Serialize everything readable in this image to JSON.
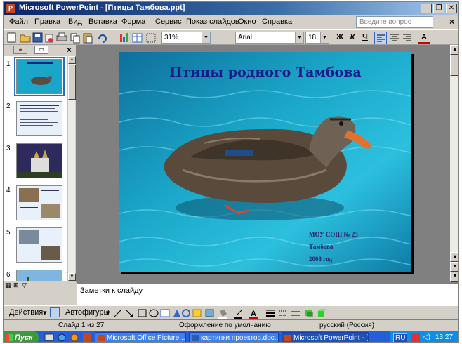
{
  "window": {
    "title": "Microsoft PowerPoint - [Птицы Тамбова.ppt]",
    "app_icon_letter": "P",
    "controls": {
      "minimize": "_",
      "restore": "❐",
      "close": "✕"
    }
  },
  "menubar": {
    "items": [
      "Файл",
      "Правка",
      "Вид",
      "Вставка",
      "Формат",
      "Сервис",
      "Показ слайдов",
      "Окно",
      "Справка"
    ],
    "ask_placeholder": "Введите вопрос",
    "doc_close": "×"
  },
  "toolbar": {
    "zoom": "31%",
    "font": "Arial",
    "font_size": "18",
    "bold": "Ж",
    "italic": "К",
    "underline": "Ч",
    "font_color_letter": "A"
  },
  "thumbnails": {
    "numbers": [
      "1",
      "2",
      "3",
      "4",
      "5",
      "6"
    ],
    "selected": 1
  },
  "slide": {
    "title": "Птицы родного Тамбова",
    "school": "МОУ СОШ № 23",
    "city": "Тамбова",
    "year": "2008 год"
  },
  "notes": {
    "placeholder": "Заметки к слайду"
  },
  "drawbar": {
    "actions": "Действия",
    "autoshapes": "Автофигуры"
  },
  "statusbar": {
    "slide_pos": "Слайд 1 из 27",
    "design": "Оформление по умолчанию",
    "language": "русский (Россия)"
  },
  "taskbar": {
    "start": "Пуск",
    "tasks": [
      "Microsoft Office Picture ...",
      "картинки проектов.doc...",
      "Microsoft PowerPoint - [..."
    ],
    "lang": "RU",
    "clock": "13:27"
  },
  "colors": {
    "title_bar": "#0a246a",
    "slide_title": "#1a1a8a",
    "water": "#1aa6c8",
    "taskbar": "#245edb"
  }
}
